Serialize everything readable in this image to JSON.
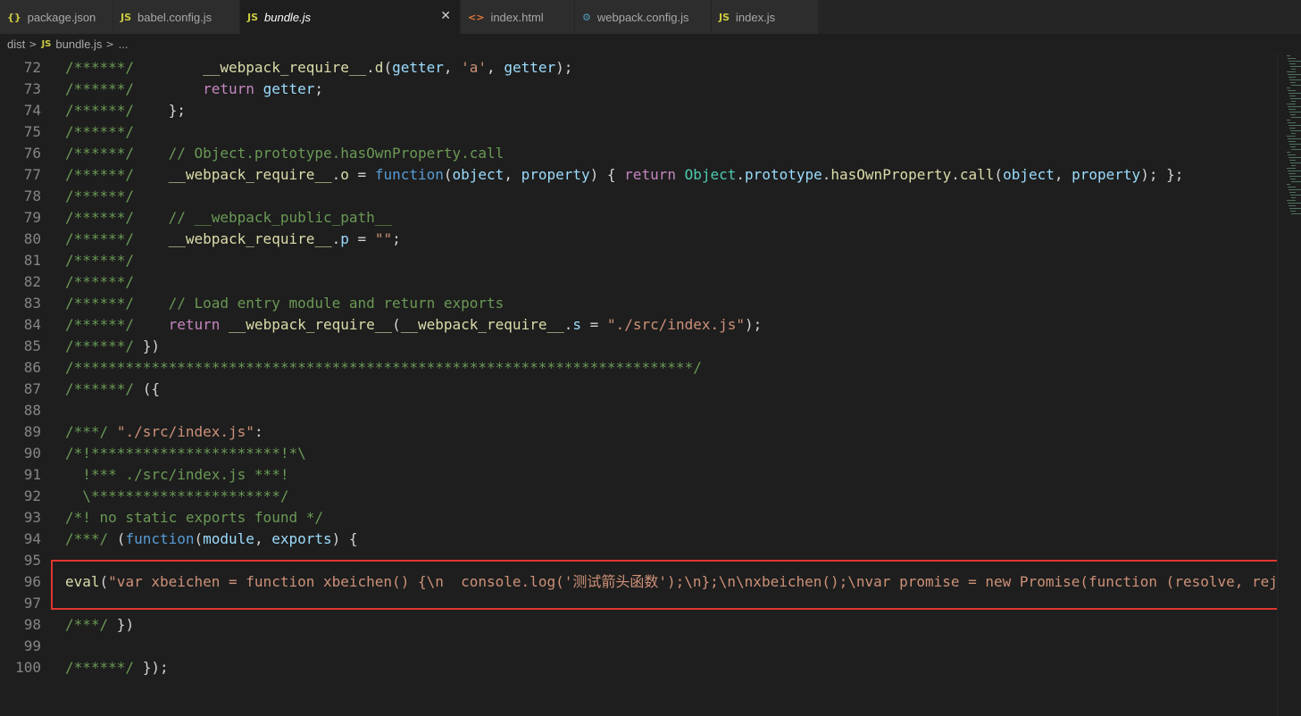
{
  "tabs": [
    {
      "name": "package.json",
      "icon": "{}",
      "icon_color": "#cbcb41",
      "active": false
    },
    {
      "name": "babel.config.js",
      "icon": "JS",
      "icon_color": "#cbcb41",
      "active": false
    },
    {
      "name": "bundle.js",
      "icon": "JS",
      "icon_color": "#cbcb41",
      "active": true
    },
    {
      "name": "index.html",
      "icon": "<>",
      "icon_color": "#e37933",
      "active": false
    },
    {
      "name": "webpack.config.js",
      "icon": "⚙",
      "icon_color": "#519aba",
      "active": false
    },
    {
      "name": "index.js",
      "icon": "JS",
      "icon_color": "#cbcb41",
      "active": false
    }
  ],
  "close_glyph": "✕",
  "breadcrumb": {
    "folder": "dist",
    "file_icon": "JS",
    "file": "bundle.js",
    "more": "..."
  },
  "highlight_color": "#e0362e",
  "lines": [
    {
      "n": "72",
      "t": [
        [
          "c",
          "/******/"
        ],
        [
          "p",
          "        "
        ],
        [
          "f",
          "__webpack_require__"
        ],
        [
          "p",
          "."
        ],
        [
          "f",
          "d"
        ],
        [
          "p",
          "("
        ],
        [
          "v",
          "getter"
        ],
        [
          "p",
          ", "
        ],
        [
          "s",
          "'a'"
        ],
        [
          "p",
          ", "
        ],
        [
          "v",
          "getter"
        ],
        [
          "p",
          ");"
        ]
      ]
    },
    {
      "n": "73",
      "t": [
        [
          "c",
          "/******/"
        ],
        [
          "p",
          "        "
        ],
        [
          "k",
          "return"
        ],
        [
          "p",
          " "
        ],
        [
          "v",
          "getter"
        ],
        [
          "p",
          ";"
        ]
      ]
    },
    {
      "n": "74",
      "t": [
        [
          "c",
          "/******/"
        ],
        [
          "p",
          "    };"
        ]
      ]
    },
    {
      "n": "75",
      "t": [
        [
          "c",
          "/******/"
        ]
      ]
    },
    {
      "n": "76",
      "t": [
        [
          "c",
          "/******/"
        ],
        [
          "p",
          "    "
        ],
        [
          "c",
          "// Object.prototype.hasOwnProperty.call"
        ]
      ]
    },
    {
      "n": "77",
      "t": [
        [
          "c",
          "/******/"
        ],
        [
          "p",
          "    "
        ],
        [
          "f",
          "__webpack_require__"
        ],
        [
          "p",
          "."
        ],
        [
          "f",
          "o"
        ],
        [
          "p",
          " = "
        ],
        [
          "b",
          "function"
        ],
        [
          "p",
          "("
        ],
        [
          "v",
          "object"
        ],
        [
          "p",
          ", "
        ],
        [
          "v",
          "property"
        ],
        [
          "p",
          ") { "
        ],
        [
          "k",
          "return"
        ],
        [
          "p",
          " "
        ],
        [
          "t",
          "Object"
        ],
        [
          "p",
          "."
        ],
        [
          "v",
          "prototype"
        ],
        [
          "p",
          "."
        ],
        [
          "f",
          "hasOwnProperty"
        ],
        [
          "p",
          "."
        ],
        [
          "f",
          "call"
        ],
        [
          "p",
          "("
        ],
        [
          "v",
          "object"
        ],
        [
          "p",
          ", "
        ],
        [
          "v",
          "property"
        ],
        [
          "p",
          "); };"
        ]
      ]
    },
    {
      "n": "78",
      "t": [
        [
          "c",
          "/******/"
        ]
      ]
    },
    {
      "n": "79",
      "t": [
        [
          "c",
          "/******/"
        ],
        [
          "p",
          "    "
        ],
        [
          "c",
          "// __webpack_public_path__"
        ]
      ]
    },
    {
      "n": "80",
      "t": [
        [
          "c",
          "/******/"
        ],
        [
          "p",
          "    "
        ],
        [
          "f",
          "__webpack_require__"
        ],
        [
          "p",
          "."
        ],
        [
          "v",
          "p"
        ],
        [
          "p",
          " = "
        ],
        [
          "s",
          "\"\""
        ],
        [
          "p",
          ";"
        ]
      ]
    },
    {
      "n": "81",
      "t": [
        [
          "c",
          "/******/"
        ]
      ]
    },
    {
      "n": "82",
      "t": [
        [
          "c",
          "/******/"
        ]
      ]
    },
    {
      "n": "83",
      "t": [
        [
          "c",
          "/******/"
        ],
        [
          "p",
          "    "
        ],
        [
          "c",
          "// Load entry module and return exports"
        ]
      ]
    },
    {
      "n": "84",
      "t": [
        [
          "c",
          "/******/"
        ],
        [
          "p",
          "    "
        ],
        [
          "k",
          "return"
        ],
        [
          "p",
          " "
        ],
        [
          "f",
          "__webpack_require__"
        ],
        [
          "p",
          "("
        ],
        [
          "f",
          "__webpack_require__"
        ],
        [
          "p",
          "."
        ],
        [
          "v",
          "s"
        ],
        [
          "p",
          " = "
        ],
        [
          "s",
          "\"./src/index.js\""
        ],
        [
          "p",
          ");"
        ]
      ]
    },
    {
      "n": "85",
      "t": [
        [
          "c",
          "/******/"
        ],
        [
          "p",
          " })"
        ]
      ]
    },
    {
      "n": "86",
      "t": [
        [
          "c",
          "/************************************************************************/"
        ]
      ]
    },
    {
      "n": "87",
      "t": [
        [
          "c",
          "/******/"
        ],
        [
          "p",
          " ({"
        ]
      ]
    },
    {
      "n": "88",
      "t": []
    },
    {
      "n": "89",
      "t": [
        [
          "c",
          "/***/"
        ],
        [
          "p",
          " "
        ],
        [
          "s",
          "\"./src/index.js\""
        ],
        [
          "p",
          ":"
        ]
      ]
    },
    {
      "n": "90",
      "t": [
        [
          "c",
          "/*!**********************!*\\"
        ]
      ]
    },
    {
      "n": "91",
      "t": [
        [
          "c",
          "  !*** ./src/index.js ***!"
        ]
      ]
    },
    {
      "n": "92",
      "t": [
        [
          "c",
          "  \\**********************/"
        ]
      ]
    },
    {
      "n": "93",
      "t": [
        [
          "c",
          "/*! no static exports found */"
        ]
      ]
    },
    {
      "n": "94",
      "t": [
        [
          "c",
          "/***/"
        ],
        [
          "p",
          " ("
        ],
        [
          "b",
          "function"
        ],
        [
          "p",
          "("
        ],
        [
          "v",
          "module"
        ],
        [
          "p",
          ", "
        ],
        [
          "v",
          "exports"
        ],
        [
          "p",
          ") {"
        ]
      ]
    },
    {
      "n": "95",
      "t": []
    },
    {
      "n": "96",
      "t": [
        [
          "f",
          "eval"
        ],
        [
          "p",
          "("
        ],
        [
          "s",
          "\"var xbeichen = function xbeichen() {\\n  console.log('测试箭头函数');\\n};\\n\\nxbeichen();\\nvar promise = new Promise(function (resolve, reject) {"
        ]
      ]
    },
    {
      "n": "97",
      "t": []
    },
    {
      "n": "98",
      "t": [
        [
          "c",
          "/***/"
        ],
        [
          "p",
          " })"
        ]
      ]
    },
    {
      "n": "99",
      "t": []
    },
    {
      "n": "100",
      "t": [
        [
          "c",
          "/******/"
        ],
        [
          "p",
          " });"
        ]
      ]
    }
  ]
}
